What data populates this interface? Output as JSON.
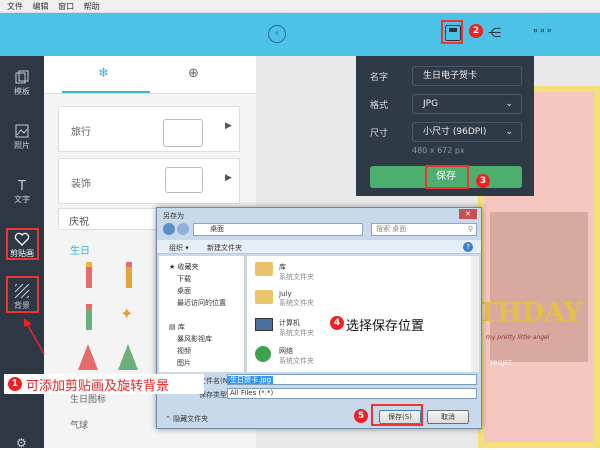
{
  "menu": [
    "文件",
    "编辑",
    "窗口",
    "帮助"
  ],
  "nav": [
    {
      "label": "模板",
      "icon": "template-icon"
    },
    {
      "label": "照片",
      "icon": "photo-icon"
    },
    {
      "label": "文字",
      "icon": "text-icon"
    },
    {
      "label": "剪贴画",
      "icon": "heart-icon"
    },
    {
      "label": "背景",
      "icon": "background-icon"
    }
  ],
  "panel": {
    "categories": [
      "旅行",
      "装饰",
      "庆祝"
    ],
    "section": "生日",
    "bottom": [
      "生日图标",
      "气球"
    ]
  },
  "save_panel": {
    "name_label": "名字",
    "name_value": "生日电子贺卡",
    "format_label": "格式",
    "format_value": "JPG",
    "size_label": "尺寸",
    "size_value": "小尺寸 (96DPI)",
    "dims": "480 x 672 px",
    "save": "保存"
  },
  "dialog": {
    "title": "另存为",
    "path": "桌面",
    "search_placeholder": "搜索 桌面",
    "organize": "组织 ▾",
    "new_folder": "新建文件夹",
    "tree": [
      "收藏夹",
      "下载",
      "桌面",
      "最近访问的位置",
      "库",
      "暴风影视库",
      "视频",
      "图片"
    ],
    "files": [
      {
        "name": "库",
        "desc": "系统文件夹"
      },
      {
        "name": "July",
        "desc": "系统文件夹"
      },
      {
        "name": "计算机",
        "desc": "系统文件夹"
      },
      {
        "name": "网络",
        "desc": "系统文件夹"
      }
    ],
    "filename_label": "文件名(N):",
    "filename": "生日贺卡.jpg",
    "filetype_label": "保存类型(T):",
    "filetype": "All Files (*.*)",
    "hide_folders": "隐藏文件夹",
    "save": "保存(S)",
    "cancel": "取消"
  },
  "annotations": {
    "n1": "1",
    "t1": "可添加剪贴画及旋转背景",
    "n2": "2",
    "n3": "3",
    "n4": "4",
    "t4": "选择保存位置",
    "n5": "5"
  },
  "card": {
    "line1": "THDAY",
    "line2": "my pretty little angel",
    "line3": "PROJET"
  },
  "colors": {
    "top": "#4bc2e6",
    "nav": "#2e3744",
    "save": "#4caf6e",
    "red": "#e22"
  }
}
